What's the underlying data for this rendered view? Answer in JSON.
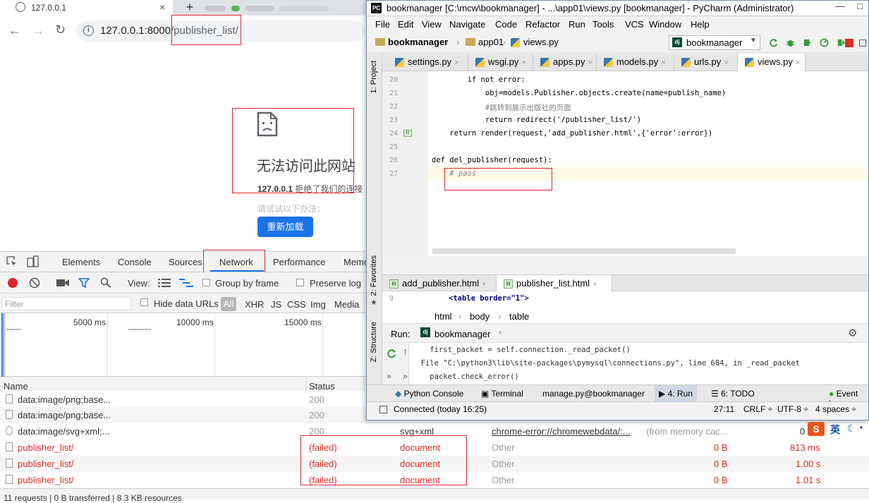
{
  "browser": {
    "tab_title": "127.0.0.1",
    "tab_close": "×",
    "new_tab": "+",
    "nav": {
      "back": "←",
      "forward": "→",
      "reload": "↻"
    },
    "url_host": "127.0.0.1:8000",
    "url_path": "/publisher_list/"
  },
  "error_page": {
    "title": "无法访问此网站",
    "host_bold": "127.0.0.1",
    "host_rest": " 拒绝了我们的连接",
    "suggest": "请试试以下办法：",
    "reload_button": "重新加载"
  },
  "devtools": {
    "tabs": [
      "Elements",
      "Console",
      "Sources",
      "Network",
      "Performance",
      "Memory"
    ],
    "active_tab": "Network",
    "view_label": "View:",
    "group_by_frame": "Group by frame",
    "preserve_log": "Preserve log",
    "filter_placeholder": "Filter",
    "hide_data_urls": "Hide data URLs",
    "filter_types": [
      "All",
      "XHR",
      "JS",
      "CSS",
      "Img",
      "Media"
    ],
    "timeline_labels": [
      "5000 ms",
      "10000 ms",
      "15000 ms"
    ]
  },
  "network_table": {
    "headers": {
      "name": "Name",
      "status": "Status"
    },
    "rows": [
      {
        "name": "data:image/png;base...",
        "status": "200",
        "type": "",
        "initiator": "",
        "size": "",
        "time": ""
      },
      {
        "name": "data:image/png;base...",
        "status": "200",
        "type": "",
        "initiator": "",
        "size": "",
        "time": ""
      },
      {
        "name": "data:image/svg+xml;...",
        "status": "200",
        "type": "svg+xml",
        "initiator": "chrome-error://chromewebdata/:...",
        "size": "(from memory cac...",
        "time": "0"
      },
      {
        "name": "publisher_list/",
        "status": "(failed)",
        "type": "document",
        "initiator": "Other",
        "size": "0 B",
        "time": "813 ms"
      },
      {
        "name": "publisher_list/",
        "status": "(failed)",
        "type": "document",
        "initiator": "Other",
        "size": "0 B",
        "time": "1.00 s"
      },
      {
        "name": "publisher_list/",
        "status": "(failed)",
        "type": "document",
        "initiator": "Other",
        "size": "0 B",
        "time": "1.01 s"
      }
    ],
    "summary": "11 requests | 0 B transferred | 8.3 KB resources"
  },
  "pycharm": {
    "logo": "PC",
    "title": "bookmanager [C:\\mcw\\bookmanager] - ...\\app01\\views.py [bookmanager] - PyCharm (Administrator)",
    "window_buttons": [
      "—",
      "□"
    ],
    "menu": [
      "File",
      "Edit",
      "View",
      "Navigate",
      "Code",
      "Refactor",
      "Run",
      "Tools",
      "VCS",
      "Window",
      "Help"
    ],
    "breadcrumb": [
      "bookmanager",
      "app01",
      "views.py"
    ],
    "run_config": "bookmanager",
    "file_tabs": [
      "settings.py",
      "wsgi.py",
      "apps.py",
      "models.py",
      "urls.py",
      "views.py"
    ],
    "active_file_tab": "views.py",
    "side_labels": {
      "project": "1: Project",
      "favorites": "2: Favorites",
      "structure": "Z: Structure"
    },
    "code_lines": [
      {
        "n": "20",
        "text": "        if not error:"
      },
      {
        "n": "21",
        "text": "            obj=models.Publisher.objects.create(name=publish_name)"
      },
      {
        "n": "22",
        "text": "            #跳转到展示出版社的页面"
      },
      {
        "n": "23",
        "text": "            return redirect('/publisher_list/')"
      },
      {
        "n": "24",
        "text": "    return render(request,'add_publisher.html',{'error':error})"
      },
      {
        "n": "25",
        "text": ""
      },
      {
        "n": "26",
        "text": "def del_publisher(request):"
      },
      {
        "n": "27",
        "text": "    # pass"
      }
    ],
    "template_tabs": [
      "add_publisher.html",
      "publisher_list.html"
    ],
    "template_line_no": "9",
    "template_line": "<table border=\"1\">",
    "template_crumbs": [
      "html",
      "body",
      "table"
    ],
    "run_label": "Run:",
    "run_tab": "bookmanager",
    "run_output": [
      "    first_packet = self.connection._read_packet()",
      "  File \"C:\\python3\\lib\\site-packages\\pymysql\\connections.py\", line 684, in _read_packet",
      "    packet.check_error()"
    ],
    "bottom_tools": [
      "Python Console",
      "Terminal",
      "manage.py@bookmanager",
      "4: Run",
      "6: TODO",
      "Event Log"
    ],
    "status": {
      "message": "Connected (today 16:25)",
      "position": "27:11",
      "line_sep": "CRLF ÷",
      "encoding": "UTF-8 ÷",
      "indent": "4 spaces ÷"
    }
  },
  "ime": {
    "logo": "S",
    "lang": "英"
  },
  "colors": {
    "accent_blue": "#1a73e8",
    "error_red": "#d93025",
    "annotation_red": "#e0262d"
  }
}
